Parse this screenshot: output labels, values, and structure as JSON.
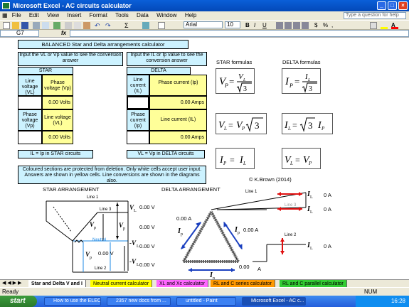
{
  "window": {
    "title": "Microsoft Excel - AC circuits calculator"
  },
  "menu": [
    "File",
    "Edit",
    "View",
    "Insert",
    "Format",
    "Tools",
    "Data",
    "Window",
    "Help"
  ],
  "help_placeholder": "Type a question for help",
  "font": {
    "name": "Arial",
    "size": "10"
  },
  "namebox": "G7",
  "fx_label": "fx",
  "sheet": {
    "title": "BALANCED Star and Delta arrangements calculator",
    "star_input_note": "Input the VL or Vp value to see the conversion answer",
    "delta_input_note": "Input the IL or Ip value to see the conversion answer",
    "star_header": "STAR",
    "delta_header": "DELTA",
    "star_line_voltage": "Line voltage (VL)",
    "star_phase_voltage_p": "Phase voltage (Vp)",
    "star_result1": "0.00 Volts",
    "star_phase_voltage_label": "Phase voltage (Vp)",
    "star_line_voltage_label": "Line voltage (VL)",
    "star_result2": "0.00 Volts",
    "delta_line_current": "Line current (IL)",
    "delta_phase_current": "Phase current (Ip)",
    "delta_result1": "0.00 Amps",
    "delta_phase_current_label": "Phase current (Ip)",
    "delta_line_current_label": "Line current (IL)",
    "delta_result2": "0.00 Amps",
    "star_note": "IL = Ip in STAR circuits",
    "delta_note": "VL = Vp in DELTA circuits",
    "info": "Coloured sections are protected from deletion. Only white cells accept user input. Answers are shown in yellow cells. Line conversions are shown in the diagrams also.",
    "star_formulas": "STAR formulas",
    "delta_formulas": "DELTA formulas",
    "copyright": "© K.Brown (2014)",
    "star_arrangement": "STAR ARRANGEMENT",
    "delta_arrangement": "DELTA ARRANGEMENT",
    "star_diagram": {
      "line1": "Line 1",
      "line3": "Line 3",
      "neutral": "Neutral",
      "line2": "Line 2",
      "v1": "0.00 V",
      "v2": "0.00 V",
      "v3": "0.00 V",
      "v4": "0.00 V",
      "v5": "0.00 V"
    },
    "delta_diagram": {
      "line1": "Line 1",
      "line3": "Line 3",
      "line2": "Line 2",
      "a1": "0 A",
      "a2": "0 A",
      "a3": "0 A",
      "ip1": "0.00 A",
      "ip2": "0.00 A",
      "ip3": "0.00",
      "ip3_unit": "A"
    }
  },
  "tabs": [
    "Star and Delta V and I",
    "Neutral current calculator",
    "XL and Xc calculator",
    "RL and C series calculator",
    "RL and C parallel calculator"
  ],
  "tab_colors": [
    "#ffffff",
    "#ffff00",
    "#ff66ff",
    "#ff9900",
    "#33cc33"
  ],
  "status": {
    "left": "Ready",
    "right": "NUM"
  },
  "taskbar": {
    "start": "start",
    "items": [
      "How to use the ELEC...",
      "2357 new docs from ...",
      "untitled - Paint",
      "Microsoft Excel - AC c..."
    ],
    "clock": "16:28"
  }
}
